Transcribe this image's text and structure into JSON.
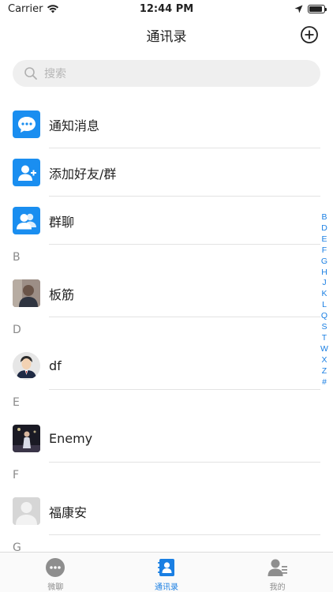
{
  "status_bar": {
    "carrier": "Carrier",
    "time": "12:44 PM",
    "battery_level": 0.9
  },
  "nav": {
    "title": "通讯录"
  },
  "search": {
    "placeholder": "搜索"
  },
  "fixed_items": [
    {
      "label": "通知消息",
      "icon": "chat-bubble-icon"
    },
    {
      "label": "添加好友/群",
      "icon": "add-user-icon"
    },
    {
      "label": "群聊",
      "icon": "group-icon"
    }
  ],
  "sections": [
    {
      "letter": "B",
      "contacts": [
        {
          "name": "板筋",
          "avatar": "photo-avatar"
        }
      ]
    },
    {
      "letter": "D",
      "contacts": [
        {
          "name": "df",
          "avatar": "cartoon-person-avatar"
        }
      ]
    },
    {
      "letter": "E",
      "contacts": [
        {
          "name": "Enemy",
          "avatar": "photo-avatar"
        }
      ]
    },
    {
      "letter": "F",
      "contacts": [
        {
          "name": "福康安",
          "avatar": "default-avatar"
        }
      ]
    },
    {
      "letter": "G",
      "contacts": []
    }
  ],
  "index_letters": [
    "B",
    "D",
    "E",
    "F",
    "G",
    "H",
    "J",
    "K",
    "L",
    "Q",
    "S",
    "T",
    "W",
    "X",
    "Z",
    "#"
  ],
  "tabs": [
    {
      "label": "微聊",
      "icon": "chat-tab-icon",
      "active": false
    },
    {
      "label": "通讯录",
      "icon": "contacts-tab-icon",
      "active": true
    },
    {
      "label": "我的",
      "icon": "profile-tab-icon",
      "active": false
    }
  ],
  "colors": {
    "accent": "#1a7fe3",
    "icon_blue": "#1a8ef0",
    "search_bg": "#efefef"
  }
}
